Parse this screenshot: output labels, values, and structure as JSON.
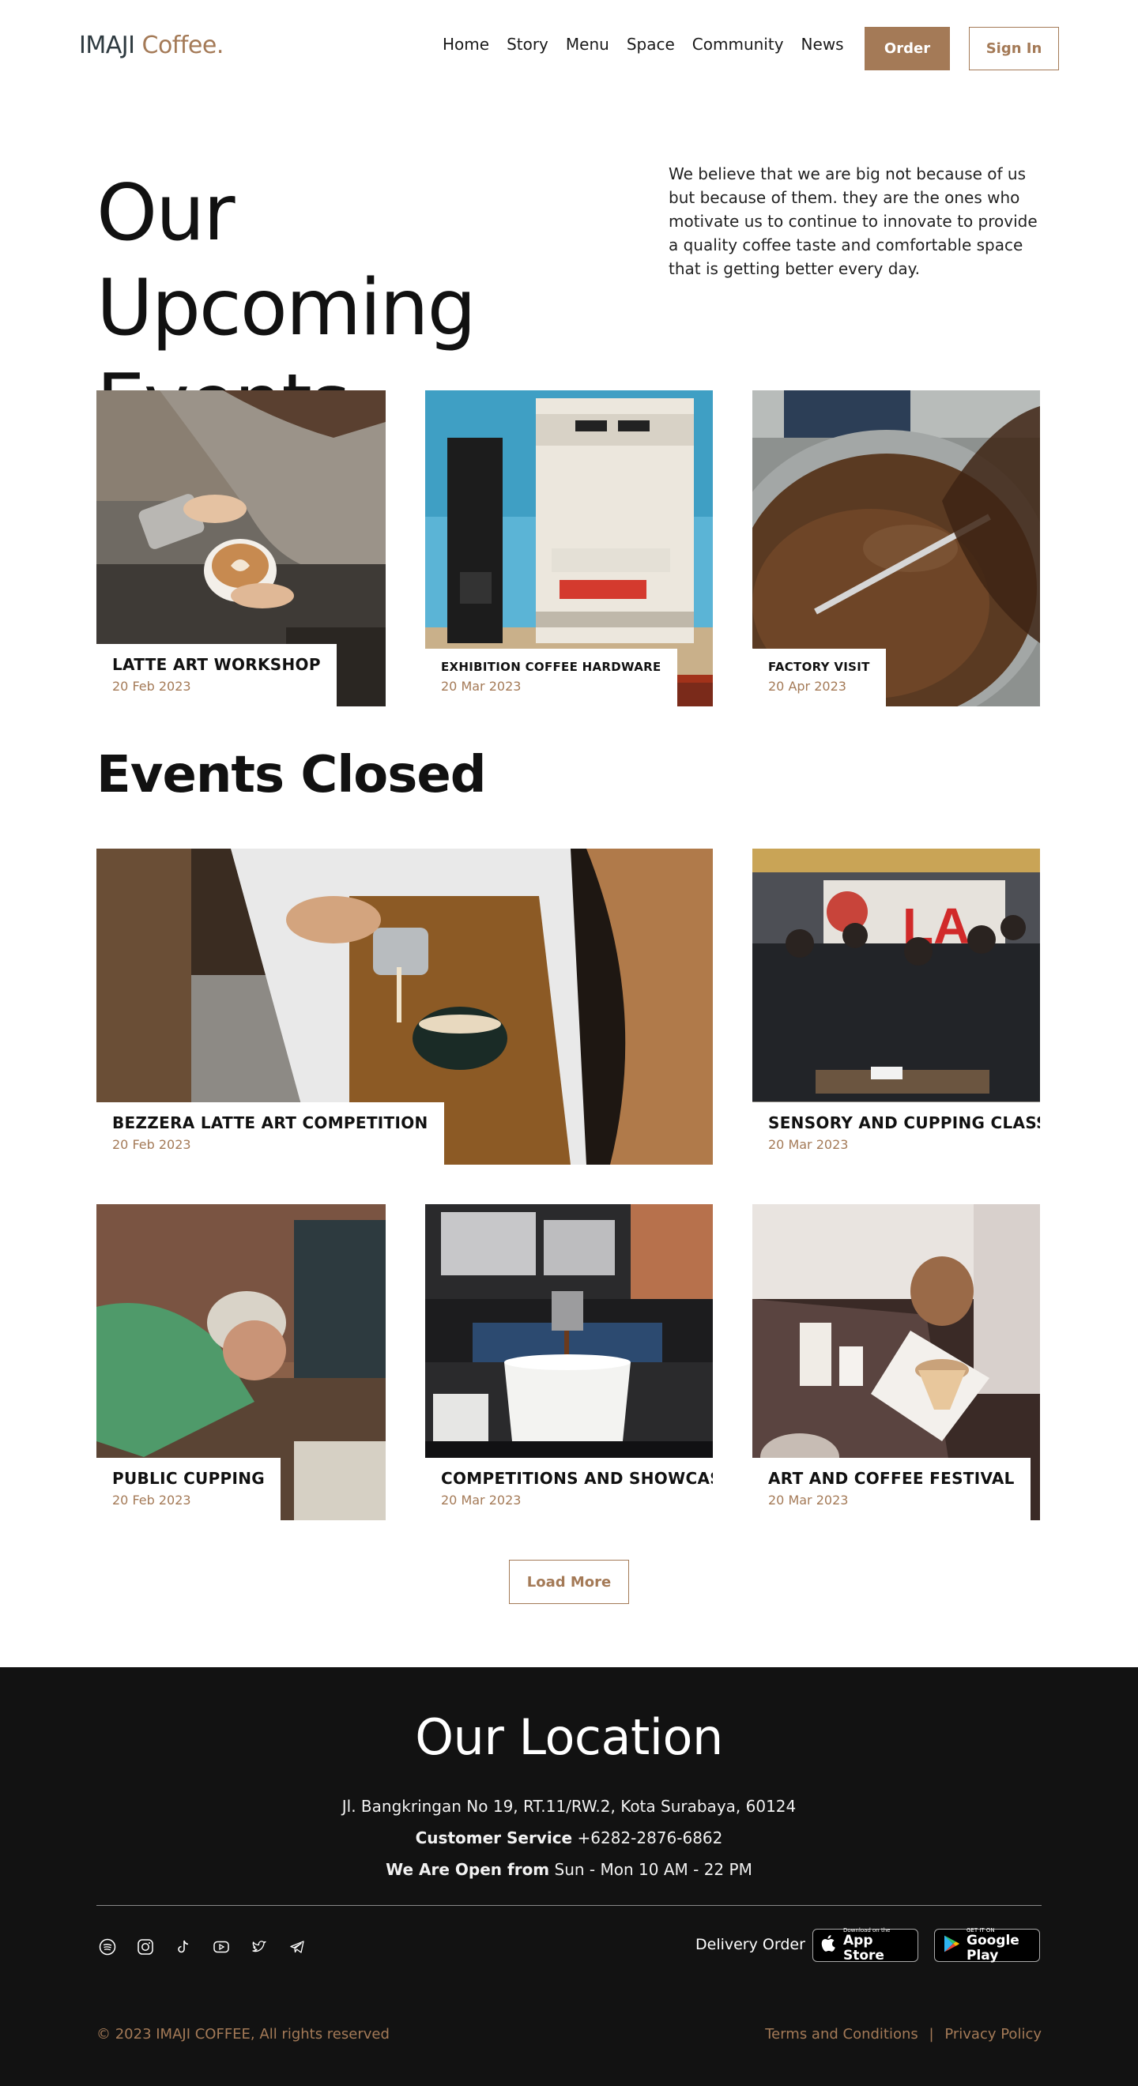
{
  "header": {
    "logo_main": "IMAJI",
    "logo_accent": "Coffee.",
    "nav": [
      "Home",
      "Story",
      "Menu",
      "Space",
      "Community",
      "News"
    ],
    "order_label": "Order",
    "signin_label": "Sign In"
  },
  "hero": {
    "title_line1": "Our Upcoming",
    "title_line2": "Events",
    "description": "We believe that we are big not because of us but because of them. they are the ones who motivate us to continue to innovate to provide a quality coffee taste and comfortable space that is getting better every day."
  },
  "upcoming": [
    {
      "title": "LATTE ART WORKSHOP",
      "date": "20 Feb 2023",
      "image": "latte-art-pouring-photo"
    },
    {
      "title": "EXHIBITION COFFEE HARDWARE",
      "date": "20 Mar 2023",
      "image": "espresso-machine-photo"
    },
    {
      "title": "FACTORY VISIT",
      "date": "20 Apr 2023",
      "image": "coffee-roaster-beans-photo"
    }
  ],
  "closed_title": "Events Closed",
  "closed": [
    {
      "title": "BEZZERA LATTE ART COMPETITION",
      "date": "20 Feb 2023",
      "image": "barista-pouring-milk-photo"
    },
    {
      "title": "SENSORY AND CUPPING CLASS",
      "date": "20 Mar 2023",
      "image": "cupping-class-group-photo"
    },
    {
      "title": "PUBLIC CUPPING",
      "date": "20 Feb 2023",
      "image": "man-cupping-coffee-photo"
    },
    {
      "title": "COMPETITIONS AND SHOWCASES",
      "date": "20 Mar 2023",
      "image": "espresso-extraction-photo"
    },
    {
      "title": "ART AND COFFEE FESTIVAL",
      "date": "20 Mar 2023",
      "image": "pour-over-brewing-photo"
    }
  ],
  "load_more_label": "Load More",
  "footer": {
    "location_title": "Our Location",
    "address": "Jl. Bangkringan No 19, RT.11/RW.2, Kota Surabaya, 60124",
    "cs_label": "Customer Service",
    "cs_value": "+6282-2876-6862",
    "hours_label": "We Are Open from",
    "hours_value": "Sun - Mon 10 AM - 22 PM",
    "social_icons": [
      "spotify-icon",
      "instagram-icon",
      "tiktok-icon",
      "youtube-icon",
      "twitter-icon",
      "telegram-icon"
    ],
    "delivery_label": "Delivery Order",
    "appstore_small": "Download on the",
    "appstore_big": "App Store",
    "googleplay_small": "GET IT ON",
    "googleplay_big": "Google Play",
    "copyright": "© 2023 IMAJI COFFEE, All rights reserved",
    "terms": "Terms and Conditions",
    "separator": "|",
    "privacy": "Privacy Policy"
  },
  "colors": {
    "accent": "#a47a57",
    "footer_bg": "#121212",
    "text": "#111111"
  }
}
